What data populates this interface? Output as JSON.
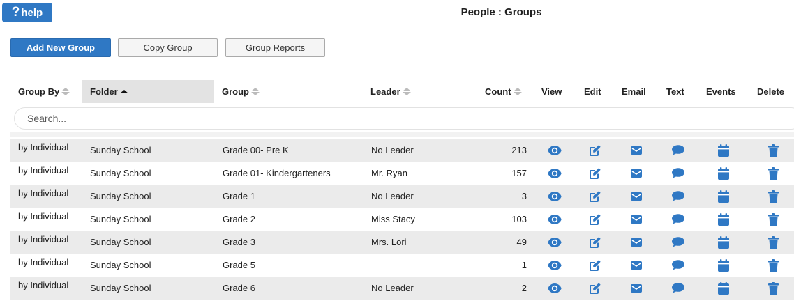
{
  "help": {
    "icon": "?",
    "label": "help"
  },
  "page_title": "People : Groups",
  "toolbar": {
    "add_label": "Add New Group",
    "copy_label": "Copy Group",
    "reports_label": "Group Reports"
  },
  "columns": {
    "group_by": "Group By",
    "folder": "Folder",
    "group": "Group",
    "leader": "Leader",
    "count": "Count",
    "view": "View",
    "edit": "Edit",
    "email": "Email",
    "text": "Text",
    "events": "Events",
    "delete": "Delete"
  },
  "sort": {
    "column": "folder",
    "direction": "ascending"
  },
  "search": {
    "placeholder": "Search...",
    "value": ""
  },
  "rows": [
    {
      "group_by": "by Individual",
      "folder": "Sunday School",
      "group": "Grade 00-  Pre K",
      "leader": "No Leader",
      "count": "213"
    },
    {
      "group_by": "by Individual",
      "folder": "Sunday School",
      "group": "Grade 01- Kindergarteners",
      "leader": "Mr. Ryan",
      "count": "157"
    },
    {
      "group_by": "by Individual",
      "folder": "Sunday School",
      "group": "Grade 1",
      "leader": "No Leader",
      "count": "3"
    },
    {
      "group_by": "by Individual",
      "folder": "Sunday School",
      "group": "Grade 2",
      "leader": "Miss Stacy",
      "count": "103"
    },
    {
      "group_by": "by Individual",
      "folder": "Sunday School",
      "group": "Grade 3",
      "leader": "Mrs. Lori",
      "count": "49"
    },
    {
      "group_by": "by Individual",
      "folder": "Sunday School",
      "group": "Grade 5",
      "leader": "",
      "count": "1"
    },
    {
      "group_by": "by Individual",
      "folder": "Sunday School",
      "group": "Grade 6",
      "leader": "No Leader",
      "count": "2"
    }
  ],
  "icons": {
    "view": "eye-icon",
    "edit": "edit-icon",
    "email": "envelope-icon",
    "text": "comment-icon",
    "events": "calendar-icon",
    "delete": "trash-icon"
  },
  "colors": {
    "accent": "#2f78c4",
    "row_stripe": "#ebebeb",
    "active_header": "#e3e3e3"
  }
}
